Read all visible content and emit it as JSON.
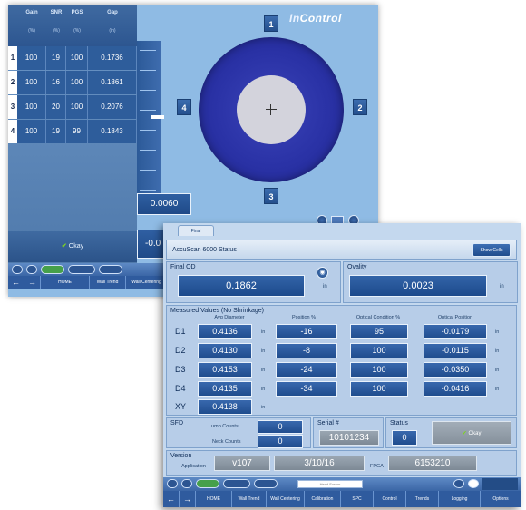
{
  "back": {
    "brand_prefix": "In",
    "brand_suffix": "Control",
    "table": {
      "headers": [
        "Gain",
        "SNR",
        "PGS",
        "Gap"
      ],
      "units": [
        "(%)",
        "(%)",
        "(%)",
        "(in)"
      ],
      "rows": [
        {
          "idx": "1",
          "gain": "100",
          "snr": "19",
          "pgs": "100",
          "gap": "0.1736"
        },
        {
          "idx": "2",
          "gain": "100",
          "snr": "16",
          "pgs": "100",
          "gap": "0.1861"
        },
        {
          "idx": "3",
          "gain": "100",
          "snr": "20",
          "pgs": "100",
          "gap": "0.2076"
        },
        {
          "idx": "4",
          "gain": "100",
          "snr": "19",
          "pgs": "99",
          "gap": "0.1843"
        }
      ]
    },
    "okay_label": "Okay",
    "sensor_labels": {
      "top": "1",
      "right": "2",
      "bottom": "3",
      "left": "4"
    },
    "value_a": "0.0060",
    "value_b": "-0.0",
    "nav": [
      "HOME",
      "Wall Trend",
      "Wall Centering"
    ]
  },
  "front": {
    "tab_label": "Final",
    "status_title": "AccuScan 6000 Status",
    "show_cells_label": "Show Cells",
    "final_od": {
      "title": "Final OD",
      "value": "0.1862",
      "unit": "in"
    },
    "ovality": {
      "title": "Ovality",
      "value": "0.0023",
      "unit": "in"
    },
    "measured": {
      "title": "Measured Values (No Shrinkage)",
      "columns": [
        "Avg Diameter",
        "Position %",
        "Optical Condition %",
        "Optical Position"
      ],
      "rows": [
        {
          "label": "D1",
          "avg": "0.4136",
          "unit": "in",
          "pos": "-16",
          "cond": "95",
          "opt": "-0.0179",
          "opt_unit": "in"
        },
        {
          "label": "D2",
          "avg": "0.4130",
          "unit": "in",
          "pos": "-8",
          "cond": "100",
          "opt": "-0.0115",
          "opt_unit": "in"
        },
        {
          "label": "D3",
          "avg": "0.4153",
          "unit": "in",
          "pos": "-24",
          "cond": "100",
          "opt": "-0.0350",
          "opt_unit": "in"
        },
        {
          "label": "D4",
          "avg": "0.4135",
          "unit": "in",
          "pos": "-34",
          "cond": "100",
          "opt": "-0.0416",
          "opt_unit": "in"
        },
        {
          "label": "XY",
          "avg": "0.4138",
          "unit": "in"
        }
      ]
    },
    "sfd": {
      "title": "SFD",
      "lump_label": "Lump Counts",
      "lump_value": "0",
      "neck_label": "Neck Counts",
      "neck_value": "0"
    },
    "serial": {
      "title": "Serial #",
      "value": "10101234"
    },
    "status": {
      "title": "Status",
      "value": "0",
      "okay_label": "Okay"
    },
    "version": {
      "title": "Version",
      "app_label": "Application",
      "app_value": "v107",
      "date_value": "3/10/16",
      "fpga_label": "FPGA",
      "fpga_value": "6153210"
    },
    "search_placeholder": "Head Fusion",
    "nav": [
      "HOME",
      "Wall Trend",
      "Wall Centering",
      "Calibration",
      "SPC",
      "Control",
      "Trends",
      "Logging",
      "Options"
    ]
  },
  "colors": {
    "accent": "#2f5b9e",
    "panel": "#c4d8ee",
    "okay_check": "#7ed321"
  }
}
